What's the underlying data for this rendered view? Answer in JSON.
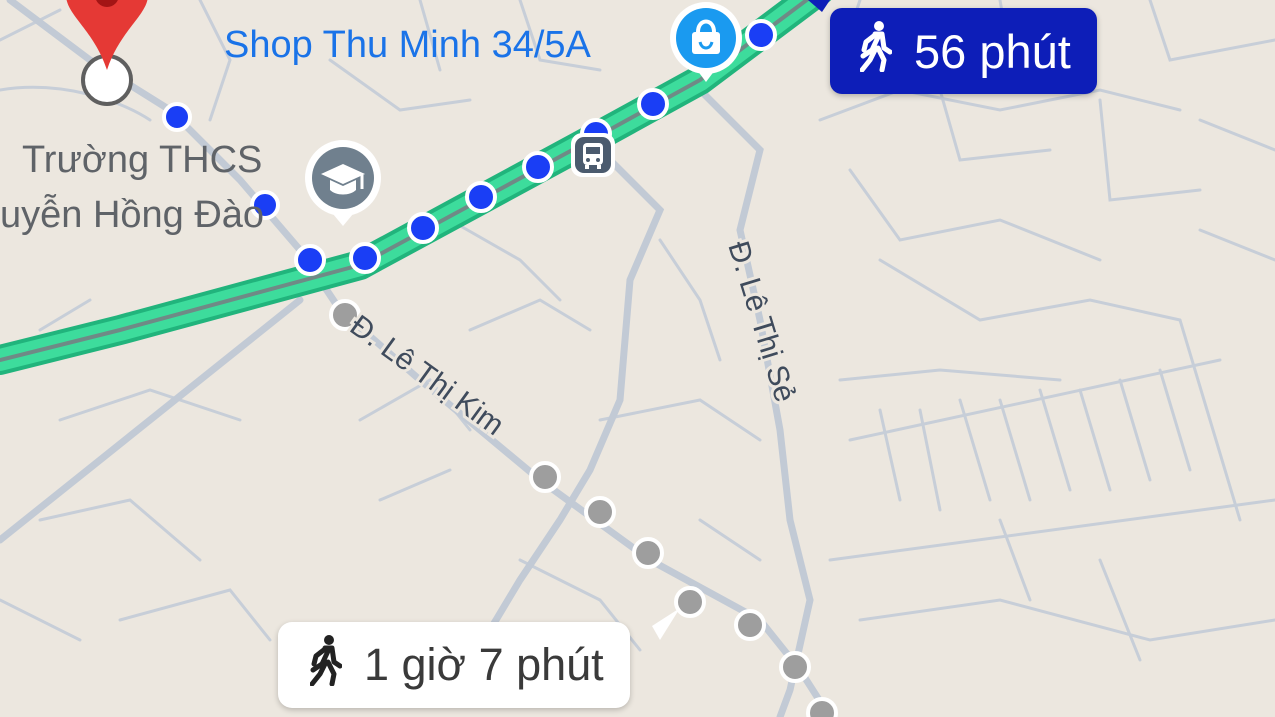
{
  "places": {
    "shop": {
      "name": "Shop Thu Minh 34/5A",
      "icon": "shopping-bag-icon",
      "color": "#1a73e8"
    },
    "school": {
      "line1": "Trường THCS",
      "line2": "uyễn Hồng Đào",
      "icon": "graduation-cap-icon",
      "color": "#5f6368"
    }
  },
  "streets": {
    "le_thi_kim": "Đ. Lê Thị Kim",
    "le_thi_se": "Đ. Lê Thị Sẻ"
  },
  "routes": {
    "primary": {
      "duration": "56 phút",
      "mode_icon": "walking-person-icon",
      "color": "#0d1eb8"
    },
    "alternative": {
      "duration": "1 giờ 7 phút",
      "mode_icon": "walking-person-icon",
      "color": "#9e9e9e"
    }
  },
  "map_colors": {
    "background": "#ece7df",
    "road": "#c5ccd6",
    "highway": "#2ecc8f",
    "route_dot_active": "#1a3ef5",
    "route_dot_alt": "#9e9e9e",
    "destination_pin": "#e53935"
  },
  "markers": {
    "destination_pin_icon": "map-pin-icon",
    "bus_stop_icon": "bus-icon"
  }
}
